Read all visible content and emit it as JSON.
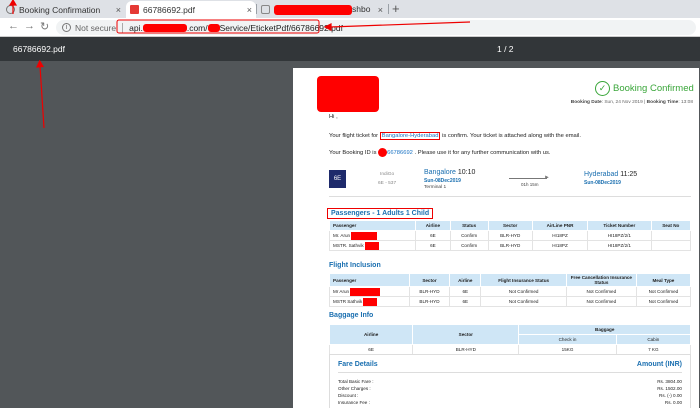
{
  "browser": {
    "tabs": [
      {
        "label": "Booking Confirmation",
        "icon": "globe-icon"
      },
      {
        "label": "66786692.pdf",
        "icon": "pdf-icon",
        "active": true
      },
      {
        "label": "shbo",
        "icon": "page-icon"
      }
    ],
    "new_tab": "+",
    "close_glyph": "×"
  },
  "address": {
    "security_label": "Not secure",
    "url_prefix": "api.",
    "url_mid": ".com/",
    "url_suffix": "Service/EticketPdf/66786692.pdf"
  },
  "pdf_toolbar": {
    "filename": "66786692.pdf",
    "page_count": "1 / 2"
  },
  "ticket": {
    "status": "Booking Confirmed",
    "booking_date_label": "Booking Date",
    "booking_date": "Sun, 24 Nov 2019",
    "booking_time_label": "Booking Time",
    "booking_time": "13:08",
    "greeting": "Hi ,",
    "msg_prefix": "Your flight ticket for",
    "route_link": "Bangalore-Hyderabad",
    "msg_suffix": "is confirm. Your ticket is attached along with the email.",
    "booking_id_prefix": "Your Booking ID is",
    "booking_id": "66786692",
    "booking_id_suffix": ". Please use it for any further communication with us.",
    "flight": {
      "airline_logo_text": "6E",
      "airline": "IndiGo",
      "flight_no": "6E - 537",
      "from_city": "Bangalore",
      "from_time": "10:10",
      "from_date": "Sun-08Dec2019",
      "from_terminal": "Terminal 1",
      "duration": "01h 15m",
      "to_city": "Hyderabad",
      "to_time": "11:25",
      "to_date": "Sun-08Dec2019"
    },
    "passengers_title": "Passengers - 1 Adults 1 Child",
    "passengers_headers": [
      "Passenger",
      "Airline",
      "Status",
      "Sector",
      "AirLine PNR",
      "Ticket Number",
      "Seat No"
    ],
    "passengers_rows": [
      [
        "Mr. Arun",
        "6E",
        "Confirm",
        "BLR-HYD",
        "HI18PZ",
        "HI18PZ/2/1",
        ""
      ],
      [
        "MSTR. Sathvik",
        "6E",
        "Confirm",
        "BLR-HYD",
        "HI18PZ",
        "HI18PZ/2/1",
        ""
      ]
    ],
    "inclusion_title": "Flight Inclusion",
    "inclusion_headers": [
      "Passenger",
      "Sector",
      "Airline",
      "Flight Insurance Status",
      "Free Cancellation Insurance Status",
      "Meal Type"
    ],
    "inclusion_rows": [
      [
        "Mr Arun",
        "BLR-HYD",
        "6E",
        "Not Confirmed",
        "Not Confirmed",
        "Not Confirmed"
      ],
      [
        "MSTR Sathvik",
        "BLR-HYD",
        "6E",
        "Not Confirmed",
        "Not Confirmed",
        "Not Confirmed"
      ]
    ],
    "baggage_title": "Baggage Info",
    "baggage_headers": [
      "Airline",
      "Sector",
      "Baggage"
    ],
    "baggage_subheaders": [
      "Check in",
      "Cabin"
    ],
    "baggage_rows": [
      [
        "6E",
        "BLR-HYD",
        "15KG",
        "7 KG"
      ]
    ],
    "fare_title": "Fare Details",
    "fare_amount_title": "Amount (INR)",
    "fare_rows": [
      {
        "label": "Total Basic Fare :",
        "value": "Rs. 3804.00"
      },
      {
        "label": "Other Charges :",
        "value": "Rs. 1502.00"
      },
      {
        "label": "Discount :",
        "value": "Rs. (-) 0.00"
      },
      {
        "label": "Insurance Fee :",
        "value": "Rs. 0.00"
      }
    ]
  },
  "colors": {
    "redaction": "#ff0000",
    "accent_blue": "#1a6fb0",
    "confirm_green": "#3aa63a",
    "pdf_toolbar": "#323639",
    "viewer_bg": "#525659"
  }
}
